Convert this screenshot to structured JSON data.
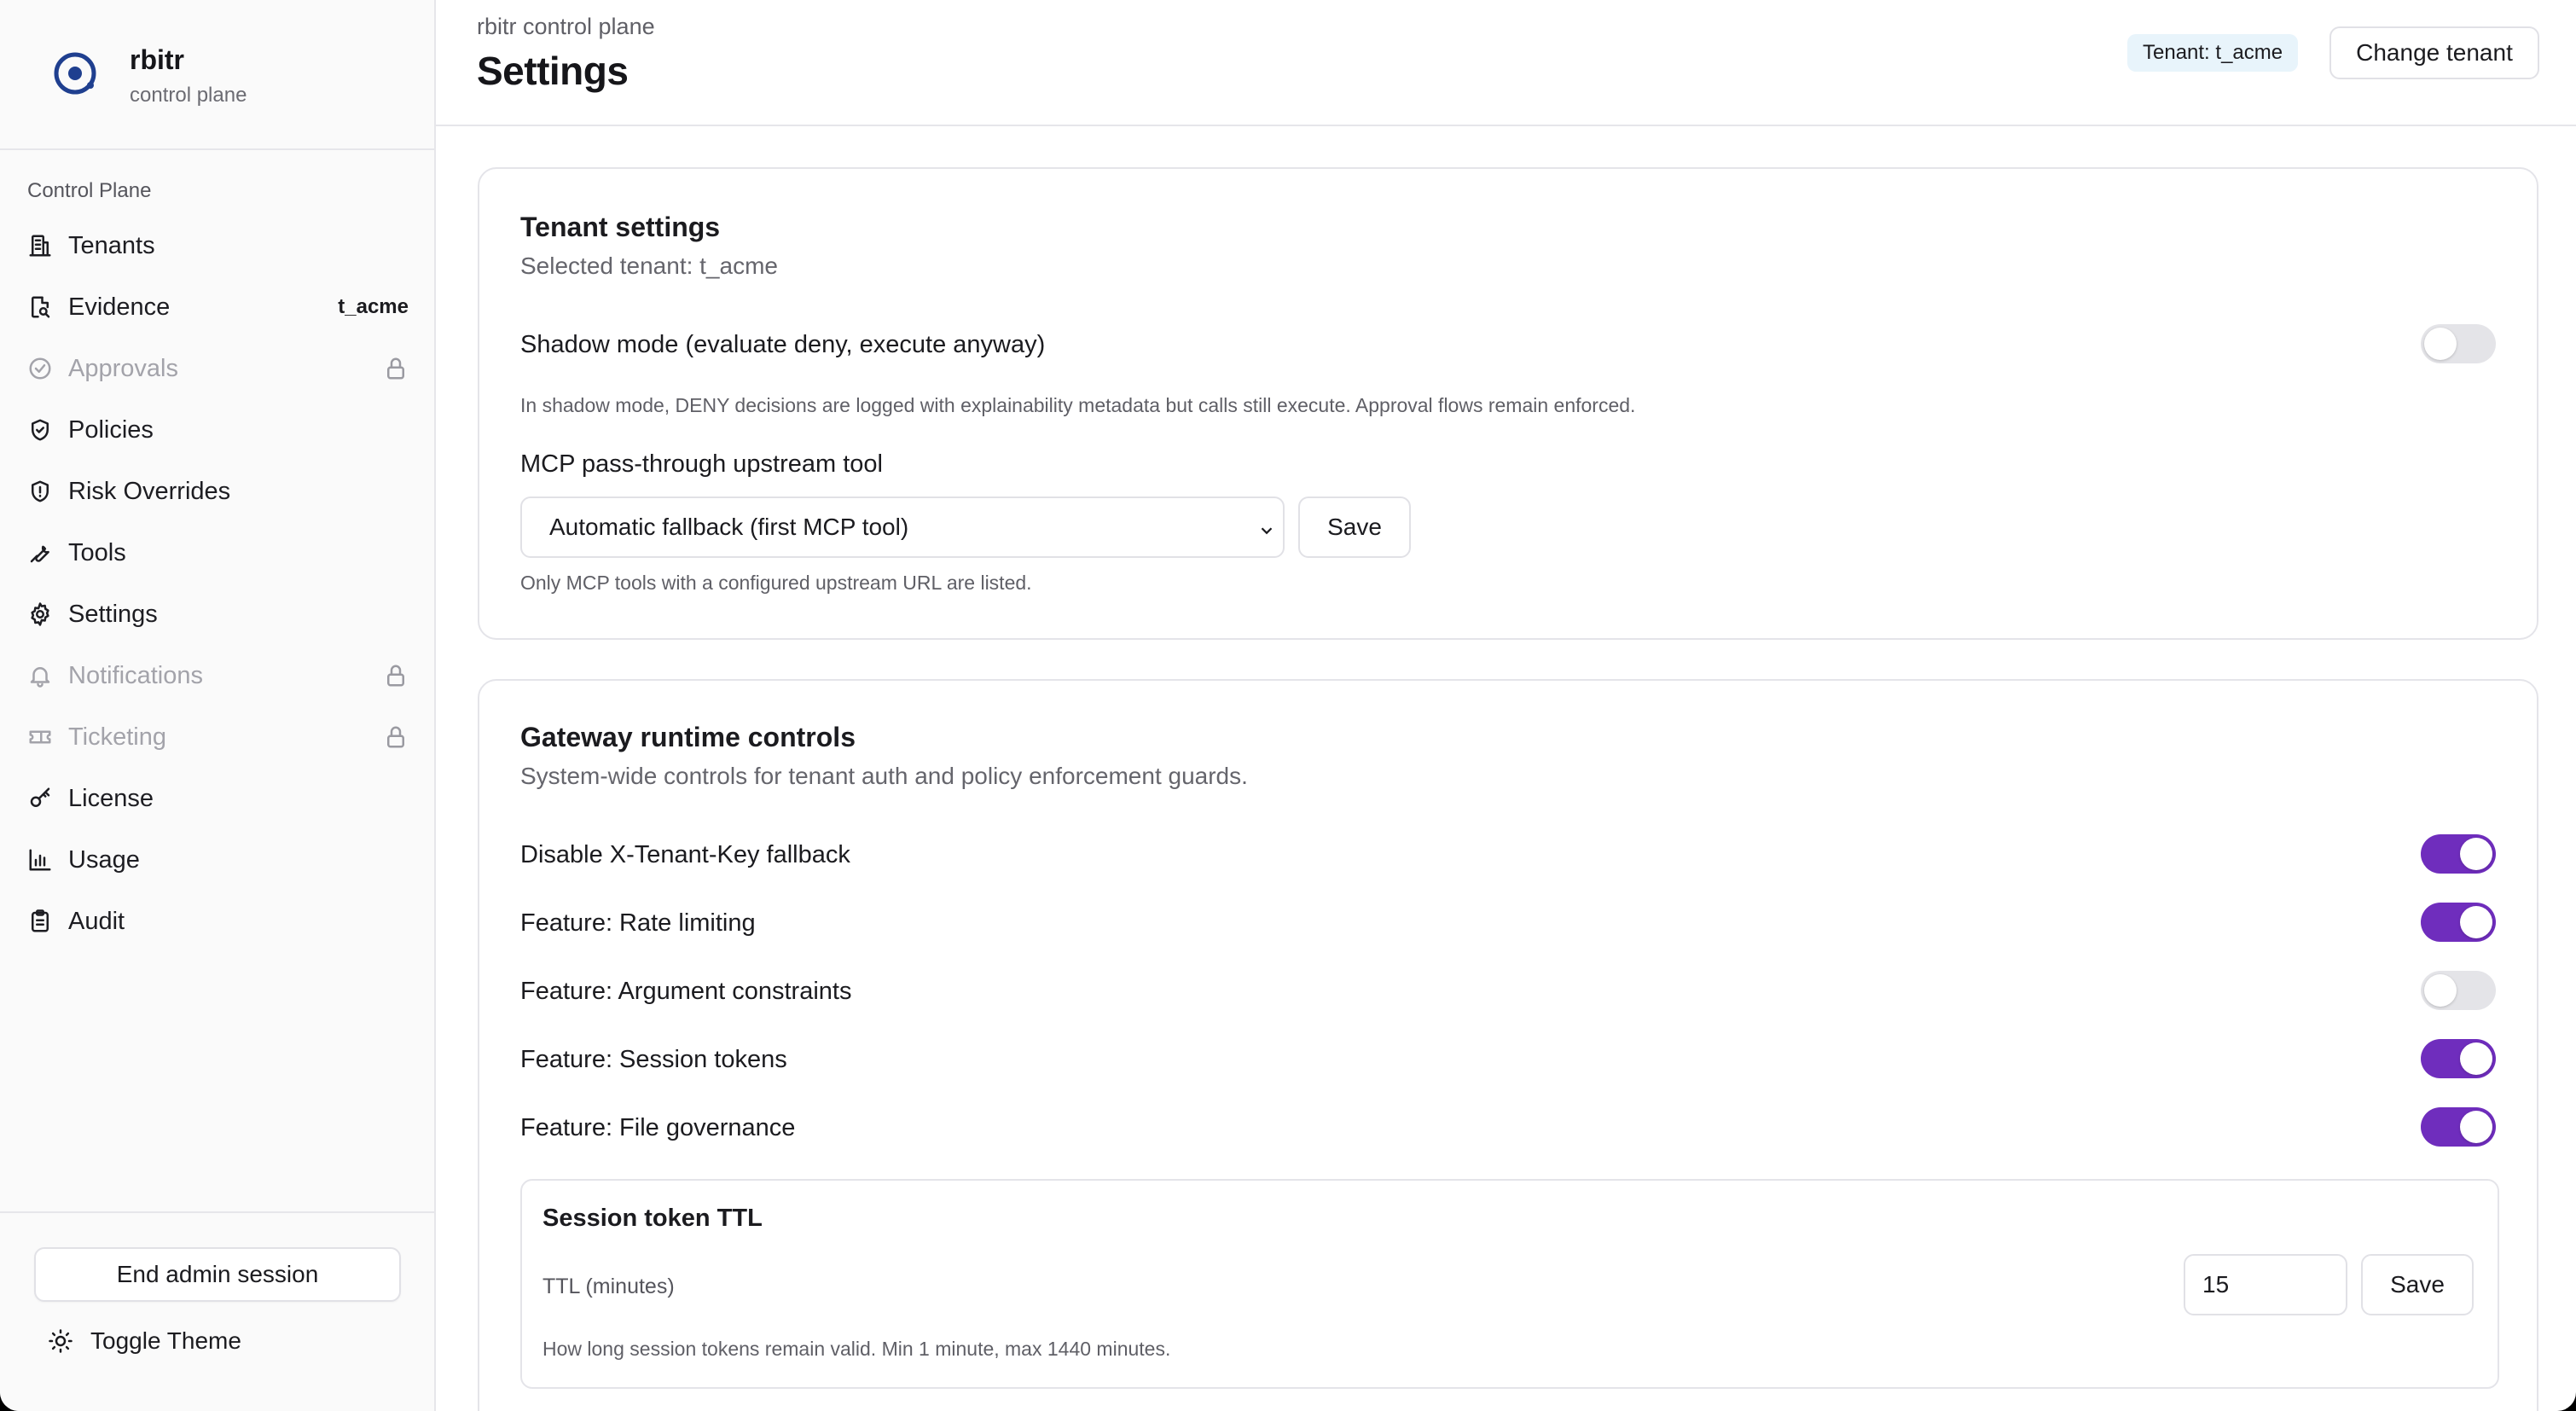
{
  "brand": {
    "name": "rbitr",
    "subtitle": "control plane",
    "logo_icon": "rbitr-logo-icon"
  },
  "sidebar": {
    "section_label": "Control Plane",
    "items": [
      {
        "label": "Tenants",
        "icon": "building-icon",
        "disabled": false
      },
      {
        "label": "Evidence",
        "icon": "file-search-icon",
        "disabled": false,
        "badge": "t_acme"
      },
      {
        "label": "Approvals",
        "icon": "check-circle-icon",
        "disabled": true,
        "locked": true
      },
      {
        "label": "Policies",
        "icon": "shield-check-icon",
        "disabled": false
      },
      {
        "label": "Risk Overrides",
        "icon": "shield-alert-icon",
        "disabled": false
      },
      {
        "label": "Tools",
        "icon": "wrench-icon",
        "disabled": false
      },
      {
        "label": "Settings",
        "icon": "gear-icon",
        "disabled": false
      },
      {
        "label": "Notifications",
        "icon": "bell-icon",
        "disabled": true,
        "locked": true
      },
      {
        "label": "Ticketing",
        "icon": "ticket-icon",
        "disabled": true,
        "locked": true
      },
      {
        "label": "License",
        "icon": "key-icon",
        "disabled": false
      },
      {
        "label": "Usage",
        "icon": "bar-chart-icon",
        "disabled": false
      },
      {
        "label": "Audit",
        "icon": "clipboard-icon",
        "disabled": false
      }
    ],
    "end_session_label": "End admin session",
    "toggle_theme_label": "Toggle Theme"
  },
  "header": {
    "breadcrumb": "rbitr control plane",
    "title": "Settings",
    "tenant_badge": "Tenant: t_acme",
    "change_tenant_label": "Change tenant"
  },
  "tenant_settings": {
    "title": "Tenant settings",
    "subtitle": "Selected tenant: t_acme",
    "shadow_mode_label": "Shadow mode (evaluate deny, execute anyway)",
    "shadow_mode_on": false,
    "shadow_mode_help": "In shadow mode, DENY decisions are logged with explainability metadata but calls still execute. Approval flows remain enforced.",
    "mcp_label": "MCP pass-through upstream tool",
    "mcp_selected": "Automatic fallback (first MCP tool)",
    "mcp_save_label": "Save",
    "mcp_help": "Only MCP tools with a configured upstream URL are listed."
  },
  "gateway": {
    "title": "Gateway runtime controls",
    "subtitle": "System-wide controls for tenant auth and policy enforcement guards.",
    "toggles": [
      {
        "label": "Disable X-Tenant-Key fallback",
        "on": true
      },
      {
        "label": "Feature: Rate limiting",
        "on": true
      },
      {
        "label": "Feature: Argument constraints",
        "on": false
      },
      {
        "label": "Feature: Session tokens",
        "on": true
      },
      {
        "label": "Feature: File governance",
        "on": true
      }
    ],
    "session_ttl": {
      "title": "Session token TTL",
      "field_label": "TTL (minutes)",
      "value": "15",
      "save_label": "Save",
      "help": "How long session tokens remain valid. Min 1 minute, max 1440 minutes."
    }
  },
  "colors": {
    "accent": "#6f2dbd",
    "tenant_badge_bg": "#e8f4fb",
    "logo_blue": "#1f3f8f"
  }
}
